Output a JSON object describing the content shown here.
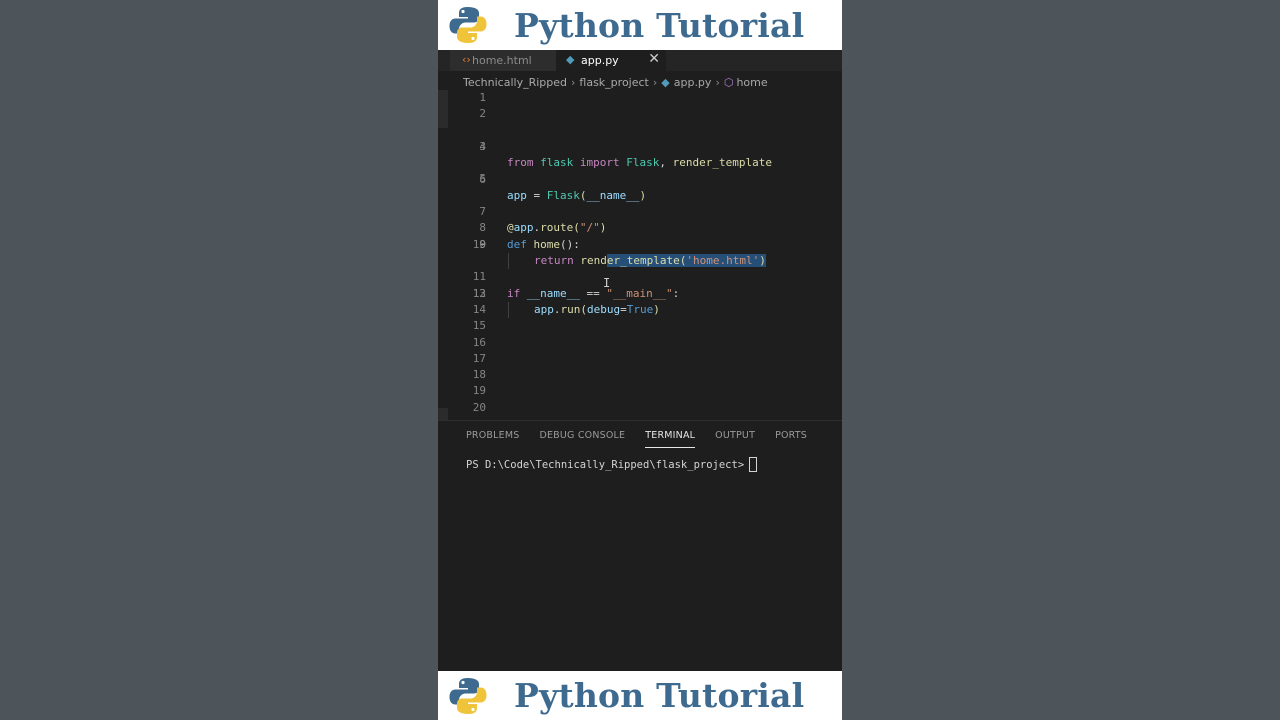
{
  "banner": {
    "title": "Python Tutorial"
  },
  "tabs": [
    {
      "label": "home.html",
      "icon": "html-file-icon"
    },
    {
      "label": "app.py",
      "icon": "python-file-icon",
      "close": "✕"
    }
  ],
  "breadcrumb": {
    "items": [
      "Technically_Ripped",
      "flask_project",
      "app.py",
      "home"
    ],
    "separator": "›"
  },
  "editor": {
    "line_numbers": [
      "1",
      "2",
      "3",
      "4",
      "5",
      "6",
      "7",
      "8",
      "9",
      "10",
      "11",
      "12",
      "13",
      "14",
      "15",
      "16",
      "17",
      "18",
      "19",
      "20"
    ],
    "active_line": "9",
    "code": {
      "l3": {
        "from": "from",
        "flask": "flask",
        "import": "import",
        "Flask": "Flask",
        "rest": ", ",
        "render": "render_template"
      },
      "l5": {
        "app": "app",
        "eq": " = ",
        "Flask": "Flask",
        "paren1": "(",
        "name": "__name__",
        "paren2": ")"
      },
      "l7": {
        "at": "@",
        "app": "app",
        "dot": ".",
        "route": "route",
        "p1": "(",
        "str": "\"/\"",
        "p2": ")"
      },
      "l8": {
        "def": "def",
        "sp": " ",
        "home": "home",
        "rest": "():"
      },
      "l9": {
        "return": "return",
        "sp": " ",
        "ren_a": "rend",
        "ren_b": "er_template",
        "p1": "(",
        "str": "'home.html'",
        "p2": ")"
      },
      "l11": {
        "if": "if",
        "sp": " ",
        "name": "__name__",
        "eq": " == ",
        "str": "\"__main__\"",
        "colon": ":"
      },
      "l12": {
        "app": "app",
        "dot": ".",
        "run": "run",
        "p1": "(",
        "debug": "debug",
        "eq": "=",
        "true": "True",
        "p2": ")"
      }
    }
  },
  "panel": {
    "tabs": [
      "PROBLEMS",
      "DEBUG CONSOLE",
      "TERMINAL",
      "OUTPUT",
      "PORTS"
    ],
    "active_tab": "TERMINAL",
    "prompt": "PS D:\\Code\\Technically_Ripped\\flask_project>"
  },
  "colors": {
    "banner_text": "#3d6a8e",
    "editor_bg": "#1e1e1e",
    "selection": "#264f78",
    "outer_bg": "#4d555b"
  }
}
